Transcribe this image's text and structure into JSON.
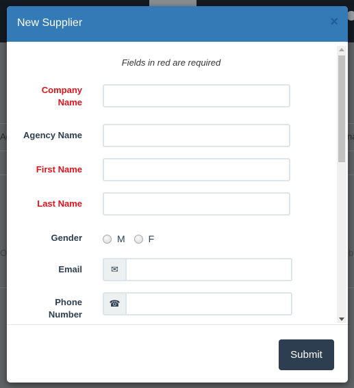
{
  "background": {
    "partial_texts": [
      "Ag",
      "na",
      "Op",
      "b",
      "o"
    ]
  },
  "modal": {
    "title": "New Supplier",
    "close_label": "×",
    "required_note": "Fields in red are required",
    "fields": [
      {
        "label": "Company Name",
        "required": true,
        "value": ""
      },
      {
        "label": "Agency Name",
        "required": false,
        "value": ""
      },
      {
        "label": "First Name",
        "required": true,
        "value": ""
      },
      {
        "label": "Last Name",
        "required": true,
        "value": ""
      }
    ],
    "gender": {
      "label": "Gender",
      "options": [
        "M",
        "F"
      ],
      "selected": null
    },
    "email": {
      "label": "Email",
      "icon": "envelope-icon",
      "value": ""
    },
    "phone": {
      "label": "Phone Number",
      "icon": "phone-icon",
      "value": ""
    },
    "submit_label": "Submit"
  }
}
